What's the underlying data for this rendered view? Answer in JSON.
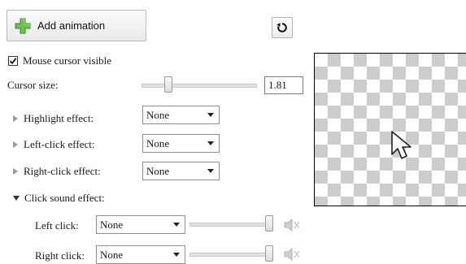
{
  "toolbar": {
    "add_animation_label": "Add animation"
  },
  "cursor": {
    "visible_label": "Mouse cursor visible",
    "visible_checked": true,
    "size_label": "Cursor size:",
    "size_value": "1.81"
  },
  "effects": {
    "highlight": {
      "label": "Highlight effect:",
      "value": "None"
    },
    "left_click": {
      "label": "Left-click effect:",
      "value": "None"
    },
    "right_click": {
      "label": "Right-click effect:",
      "value": "None"
    },
    "click_sound": {
      "label": "Click sound effect:"
    }
  },
  "sound": {
    "left": {
      "label": "Left click:",
      "value": "None",
      "volume": 1.0
    },
    "right": {
      "label": "Right click:",
      "value": "None",
      "volume": 1.0
    }
  },
  "icons": {
    "add": "plus-icon",
    "reset": "reset-icon",
    "speaker": "speaker-icon",
    "cursor": "cursor-arrow-icon"
  }
}
